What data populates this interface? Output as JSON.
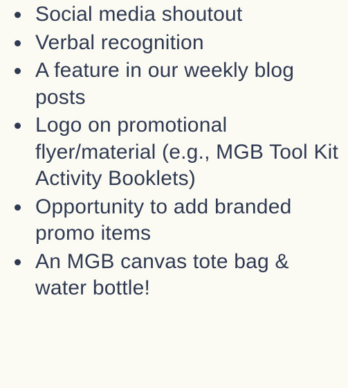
{
  "benefits": [
    "Social media shoutout",
    "Verbal recognition",
    "A feature in our weekly blog posts",
    "Logo on promotional flyer/material (e.g., MGB Tool Kit Activity Booklets)",
    "Opportunity to add branded promo items",
    "An MGB canvas tote bag & water bottle!"
  ],
  "colors": {
    "background": "#fcfbf3",
    "text": "#2f3a52"
  }
}
